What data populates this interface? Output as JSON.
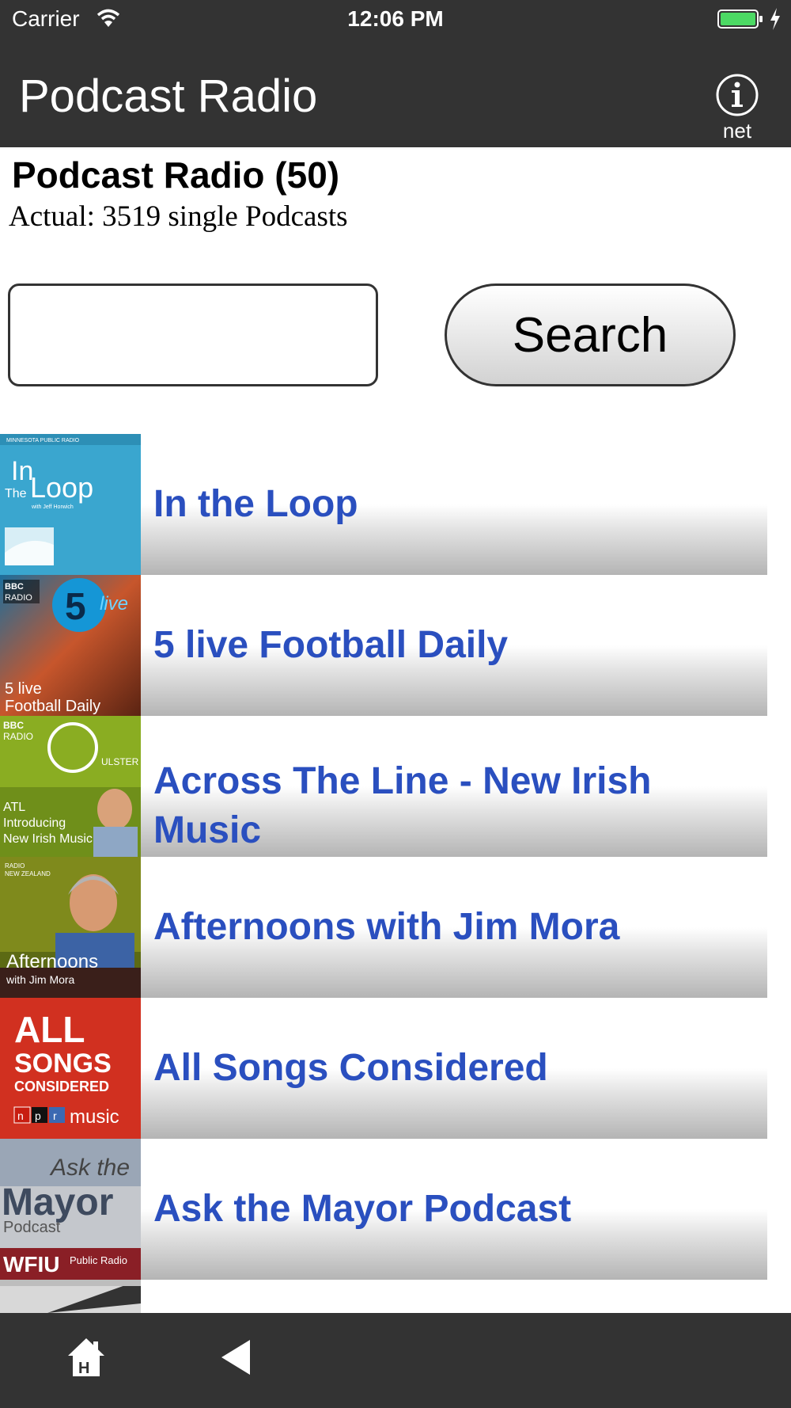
{
  "status_bar": {
    "carrier": "Carrier",
    "time": "12:06 PM",
    "battery_color": "#4cd964"
  },
  "nav_bar": {
    "title": "Podcast Radio",
    "info_label": "net"
  },
  "header": {
    "title": "Podcast Radio (50)",
    "subtitle": "Actual: 3519 single Podcasts"
  },
  "search": {
    "value": "",
    "button_label": "Search"
  },
  "podcasts": [
    {
      "title": "In the Loop",
      "thumb_text": "In The Loop"
    },
    {
      "title": "5 live Football Daily",
      "thumb_text": "5 live Football Daily"
    },
    {
      "title": "Across The Line - New Irish Music",
      "thumb_text": "ATL Introducing New Irish Music"
    },
    {
      "title": "Afternoons with Jim Mora",
      "thumb_text": "Afternoons with Jim Mora"
    },
    {
      "title": "All Songs Considered",
      "thumb_text": "ALL SONGS CONSIDERED npr music"
    },
    {
      "title": "Ask the Mayor Podcast",
      "thumb_text": "Ask the Mayor Podcast WFIU Public Radio"
    }
  ],
  "colors": {
    "bar_background": "#333333",
    "link_text": "#2a4fbf"
  },
  "toolbar": {
    "home_icon": "home-icon",
    "back_icon": "back-icon"
  }
}
